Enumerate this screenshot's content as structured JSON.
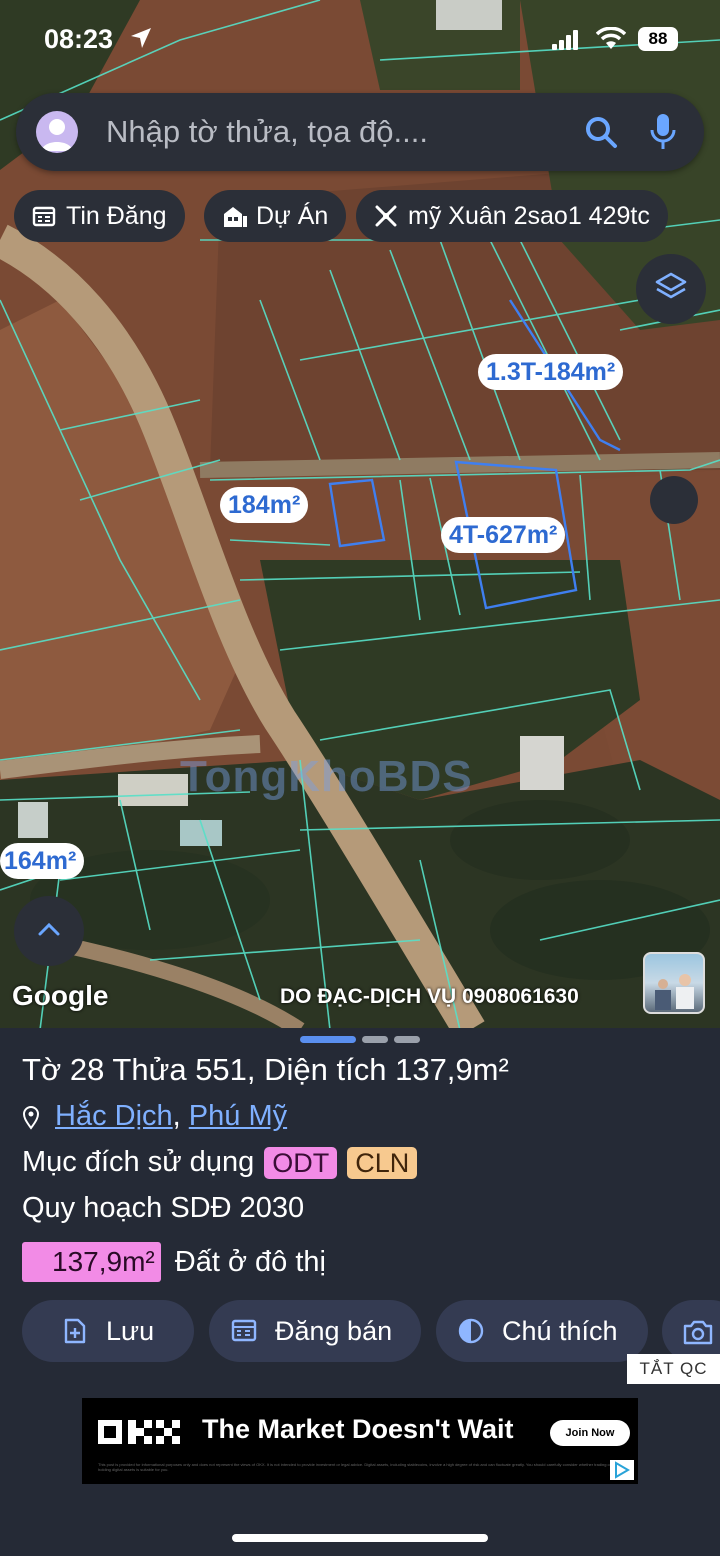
{
  "status_bar": {
    "time": "08:23",
    "battery": "88"
  },
  "search": {
    "placeholder": "Nhập tờ thửa, tọa độ...."
  },
  "chips": [
    {
      "label": "Tin Đăng",
      "icon": "calendar-icon"
    },
    {
      "label": "Dự Án",
      "icon": "building-icon"
    },
    {
      "label": "mỹ Xuân 2sao1 429tc",
      "icon": "tools-icon"
    }
  ],
  "map": {
    "parcel_labels": [
      "1.3T-184m²",
      "184m²",
      "4T-627m²",
      "164m²"
    ],
    "watermark": "TongKhoBDS",
    "attribution": "Google",
    "company": "DO ĐẠC-DỊCH VỤ 0908061630"
  },
  "parcel": {
    "title": "Tờ 28 Thửa 551, Diện tích 137,9m²",
    "location_parts": [
      "Hắc Dịch",
      "Phú Mỹ"
    ],
    "location_separator": ", ",
    "purpose_label": "Mục đích sử dụng",
    "purpose_codes": [
      "ODT",
      "CLN"
    ],
    "plan_label": "Quy hoạch SDĐ 2030",
    "area_value": "137,9m²",
    "area_type": "Đất ở đô thị"
  },
  "actions": [
    {
      "label": "Lưu",
      "icon": "save-icon"
    },
    {
      "label": "Đăng bán",
      "icon": "calendar-icon"
    },
    {
      "label": "Chú thích",
      "icon": "contrast-icon"
    },
    {
      "label": "",
      "icon": "camera-icon"
    }
  ],
  "ad": {
    "close_label": "TẮT QC",
    "brand": "OKX",
    "headline": "The Market Doesn't Wait",
    "cta": "Join Now",
    "fine_print": "This post is provided for informational purposes only and does not represent the views of OKX. It is not intended to provide investment or legal advice. Digital assets, including stablecoins, involve a high degree of risk and can fluctuate greatly. You should carefully consider whether trading or holding digital assets is suitable for you."
  },
  "colors": {
    "sheet_bg": "#252a36",
    "chip_bg": "#2b2f38",
    "link": "#7fb0ff",
    "odt": "#f28be6",
    "cln": "#f7c98f",
    "parcel_line": "#57e0c8",
    "selected_line": "#3f7ff0"
  }
}
